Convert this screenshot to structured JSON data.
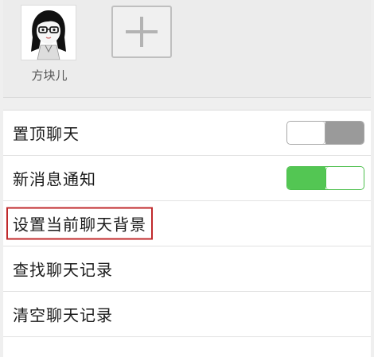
{
  "members": {
    "items": [
      {
        "name": "方块儿",
        "icon": "user-avatar"
      }
    ],
    "add_icon": "plus-icon"
  },
  "settings": [
    {
      "label": "置顶聊天",
      "control": "toggle",
      "state": "off"
    },
    {
      "label": "新消息通知",
      "control": "toggle",
      "state": "on"
    },
    {
      "label": "设置当前聊天背景",
      "control": "none",
      "highlighted": true
    },
    {
      "label": "查找聊天记录",
      "control": "none"
    },
    {
      "label": "清空聊天记录",
      "control": "none"
    }
  ],
  "colors": {
    "toggle_on": "#53c653",
    "toggle_off": "#9a9a9a",
    "highlight_border": "#c0292b"
  }
}
